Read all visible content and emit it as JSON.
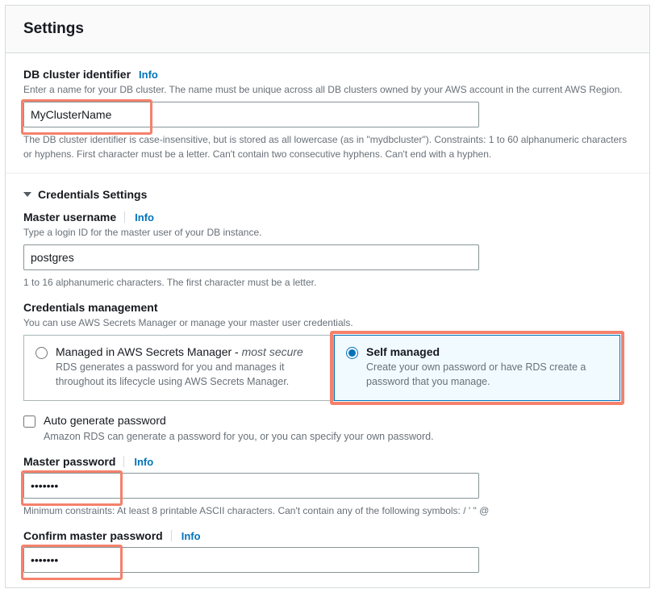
{
  "header": {
    "title": "Settings"
  },
  "clusterId": {
    "label": "DB cluster identifier",
    "info": "Info",
    "help_top": "Enter a name for your DB cluster. The name must be unique across all DB clusters owned by your AWS account in the current AWS Region.",
    "value": "MyClusterName",
    "help_bottom": "The DB cluster identifier is case-insensitive, but is stored as all lowercase (as in \"mydbcluster\"). Constraints: 1 to 60 alphanumeric characters or hyphens. First character must be a letter. Can't contain two consecutive hyphens. Can't end with a hyphen."
  },
  "credentials": {
    "section_title": "Credentials Settings",
    "username": {
      "label": "Master username",
      "info": "Info",
      "help_top": "Type a login ID for the master user of your DB instance.",
      "value": "postgres",
      "help_bottom": "1 to 16 alphanumeric characters. The first character must be a letter."
    },
    "management": {
      "label": "Credentials management",
      "help": "You can use AWS Secrets Manager or manage your master user credentials.",
      "option_managed": {
        "title": "Managed in AWS Secrets Manager - ",
        "title_suffix": "most secure",
        "desc": "RDS generates a password for you and manages it throughout its lifecycle using AWS Secrets Manager."
      },
      "option_self": {
        "title": "Self managed",
        "desc": "Create your own password or have RDS create a password that you manage."
      },
      "selected": "self"
    },
    "autogen": {
      "label": "Auto generate password",
      "help": "Amazon RDS can generate a password for you, or you can specify your own password.",
      "checked": false
    },
    "password": {
      "label": "Master password",
      "info": "Info",
      "value": "•••••••",
      "help_bottom": "Minimum constraints: At least 8 printable ASCII characters. Can't contain any of the following symbols: / ' \" @"
    },
    "confirm": {
      "label": "Confirm master password",
      "info": "Info",
      "value": "•••••••"
    }
  }
}
